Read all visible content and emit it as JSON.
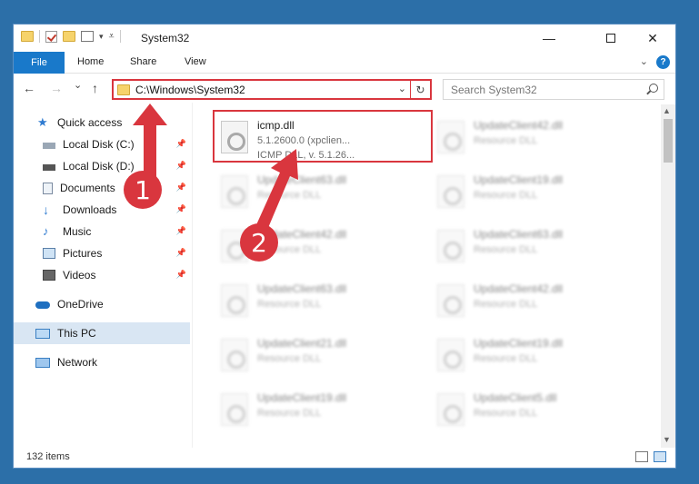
{
  "window": {
    "title": "System32"
  },
  "ribbon": {
    "tabs": [
      "File",
      "Home",
      "Share",
      "View"
    ],
    "help": "?"
  },
  "nav": {
    "back": "←",
    "forward": "→",
    "recent": "⌄",
    "up": "↑"
  },
  "address": {
    "path": "C:\\Windows\\System32",
    "refresh": "↻"
  },
  "search": {
    "placeholder": "Search System32"
  },
  "sidebar": {
    "items": [
      {
        "label": "Quick access",
        "icon": "star-icon"
      },
      {
        "label": "Local Disk (C:)",
        "icon": "drive-icon"
      },
      {
        "label": "Local Disk (D:)",
        "icon": "drive-icon"
      },
      {
        "label": "Documents",
        "icon": "documents-icon"
      },
      {
        "label": "Downloads",
        "icon": "downloads-icon"
      },
      {
        "label": "Music",
        "icon": "music-icon"
      },
      {
        "label": "Pictures",
        "icon": "pictures-icon"
      },
      {
        "label": "Videos",
        "icon": "videos-icon"
      },
      {
        "label": "OneDrive",
        "icon": "cloud-icon"
      },
      {
        "label": "This PC",
        "icon": "computer-icon"
      },
      {
        "label": "Network",
        "icon": "network-icon"
      }
    ]
  },
  "files": {
    "highlighted": {
      "name": "icmp.dll",
      "line2": "5.1.2600.0 (xpclien...",
      "line3": "ICMP DLL, v. 5.1.26..."
    },
    "col2": [
      {
        "name": "UpdateClient42.dll",
        "type": "Resource DLL"
      },
      {
        "name": "UpdateClient19.dll",
        "type": "Resource DLL"
      },
      {
        "name": "UpdateClient63.dll",
        "type": "Resource DLL"
      },
      {
        "name": "UpdateClient42.dll",
        "type": "Resource DLL"
      },
      {
        "name": "UpdateClient19.dll",
        "type": "Resource DLL"
      },
      {
        "name": "UpdateClient5.dll",
        "type": "Resource DLL"
      }
    ],
    "col1": [
      {
        "name": "UpdateClient63.dll",
        "type": "Resource DLL"
      },
      {
        "name": "UpdateClient42.dll",
        "type": "Resource DLL"
      },
      {
        "name": "UpdateClient63.dll",
        "type": "Resource DLL"
      },
      {
        "name": "UpdateClient21.dll",
        "type": "Resource DLL"
      },
      {
        "name": "UpdateClient19.dll",
        "type": "Resource DLL"
      }
    ]
  },
  "status": {
    "count": "132 items"
  },
  "annotations": {
    "step1": "1",
    "step2": "2",
    "color": "#d9363e"
  }
}
